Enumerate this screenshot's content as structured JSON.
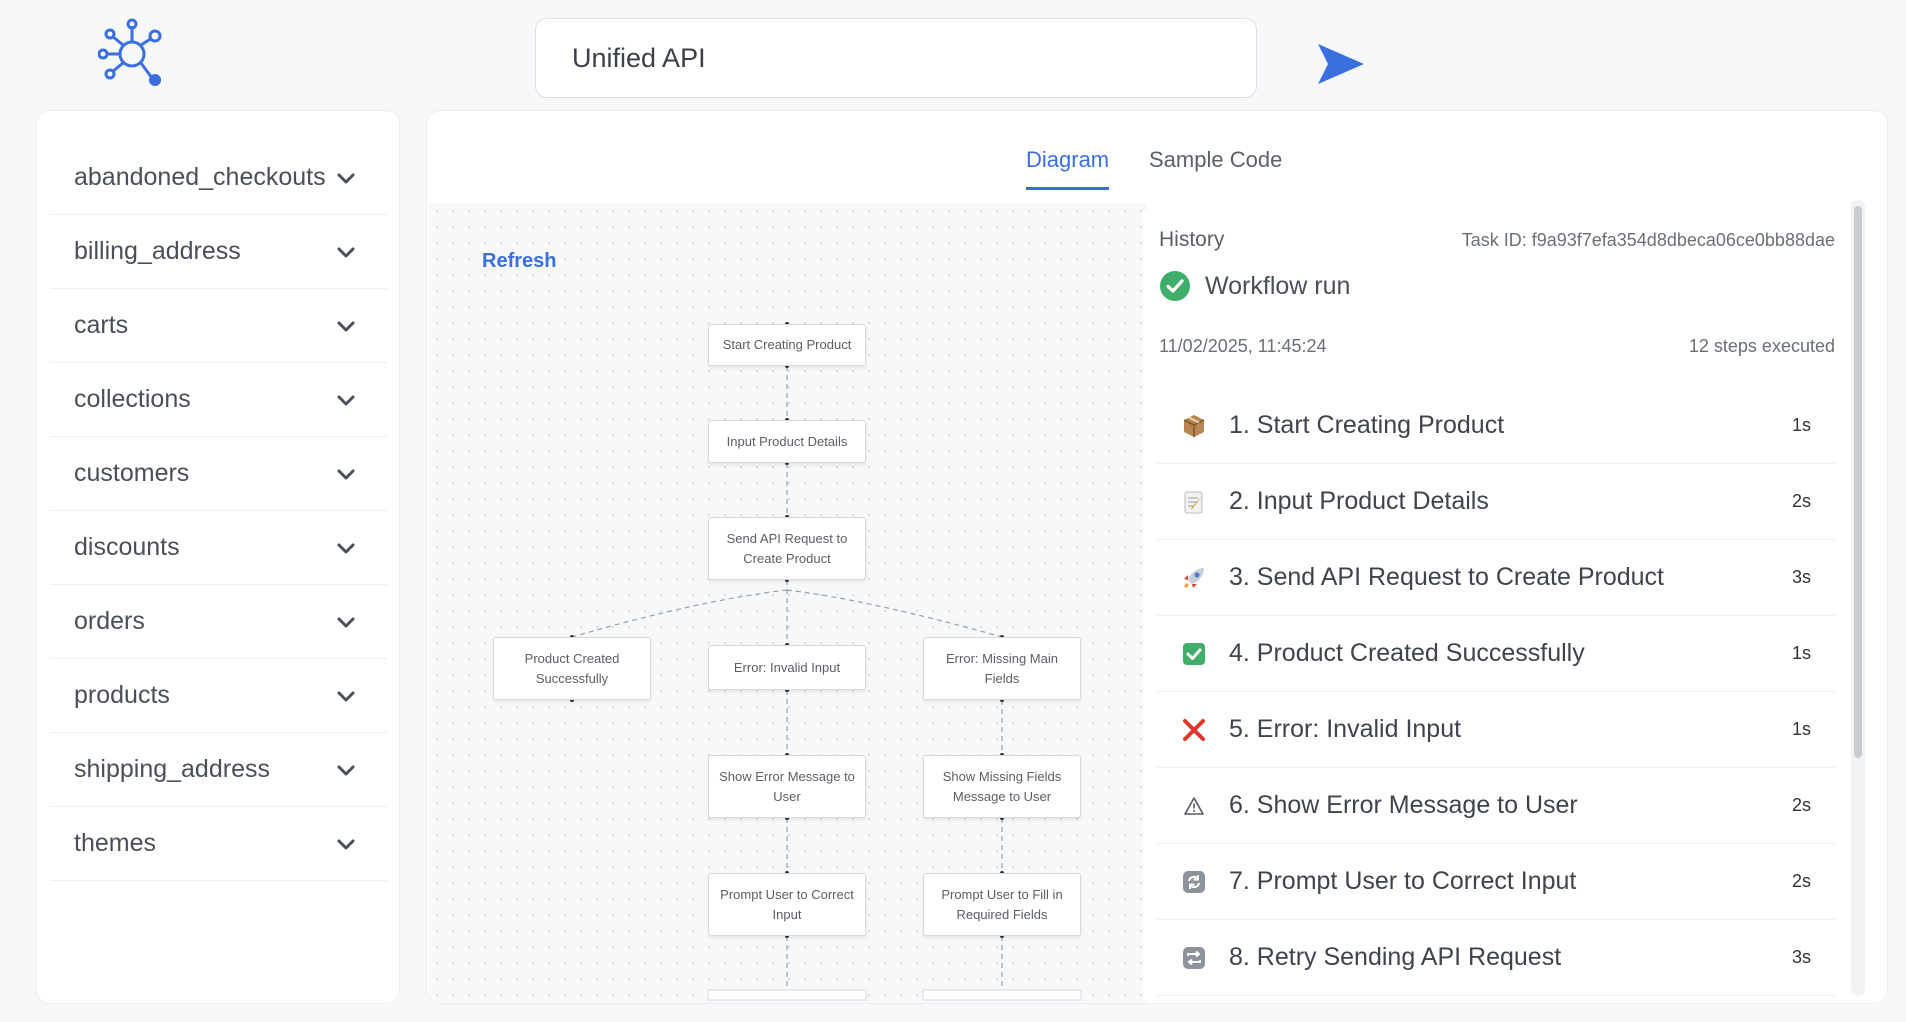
{
  "header": {
    "logo_icon": "network-hub-logo-icon",
    "search_value": "Unified API",
    "send_icon": "send-arrow-icon",
    "accent": "#3b6fe0"
  },
  "sidebar": {
    "items": [
      {
        "label": "abandoned_checkouts"
      },
      {
        "label": "billing_address"
      },
      {
        "label": "carts"
      },
      {
        "label": "collections"
      },
      {
        "label": "customers"
      },
      {
        "label": "discounts"
      },
      {
        "label": "orders"
      },
      {
        "label": "products"
      },
      {
        "label": "shipping_address"
      },
      {
        "label": "themes"
      }
    ],
    "chevron_icon": "chevron-down-icon"
  },
  "tabs": {
    "diagram": "Diagram",
    "code": "Sample Code",
    "active": "diagram"
  },
  "diagram": {
    "refresh": "Refresh",
    "nodes": {
      "start": "Start Creating Product",
      "input": "Input Product Details",
      "send": "Send API Request to Create Product",
      "success": "Product Created Successfully",
      "invalid": "Error: Invalid Input",
      "missing": "Error: Missing Main Fields",
      "show_error": "Show Error Message to User",
      "show_missing": "Show Missing Fields Message to User",
      "prompt_correct": "Prompt User to Correct Input",
      "prompt_fill": "Prompt User to Fill in Required Fields"
    }
  },
  "history": {
    "title": "History",
    "task_id": "Task ID: f9a93f7efa354d8dbeca06ce0bb88dae",
    "run_label": "Workflow run",
    "run_status_color": "#3fae6b",
    "timestamp": "11/02/2025, 11:45:24",
    "steps_executed": "12 steps executed",
    "steps": [
      {
        "label": "1. Start Creating Product",
        "duration": "1s",
        "icon": "package-icon"
      },
      {
        "label": "2. Input Product Details",
        "duration": "2s",
        "icon": "memo-icon"
      },
      {
        "label": "3. Send API Request to Create Product",
        "duration": "3s",
        "icon": "rocket-icon"
      },
      {
        "label": "4. Product Created Successfully",
        "duration": "1s",
        "icon": "check-box-icon"
      },
      {
        "label": "5. Error: Invalid Input",
        "duration": "1s",
        "icon": "cross-mark-icon"
      },
      {
        "label": "6. Show Error Message to User",
        "duration": "2s",
        "icon": "warning-icon"
      },
      {
        "label": "7. Prompt User to Correct Input",
        "duration": "2s",
        "icon": "refresh-arrows-icon"
      },
      {
        "label": "8. Retry Sending API Request",
        "duration": "3s",
        "icon": "repeat-icon"
      }
    ]
  }
}
